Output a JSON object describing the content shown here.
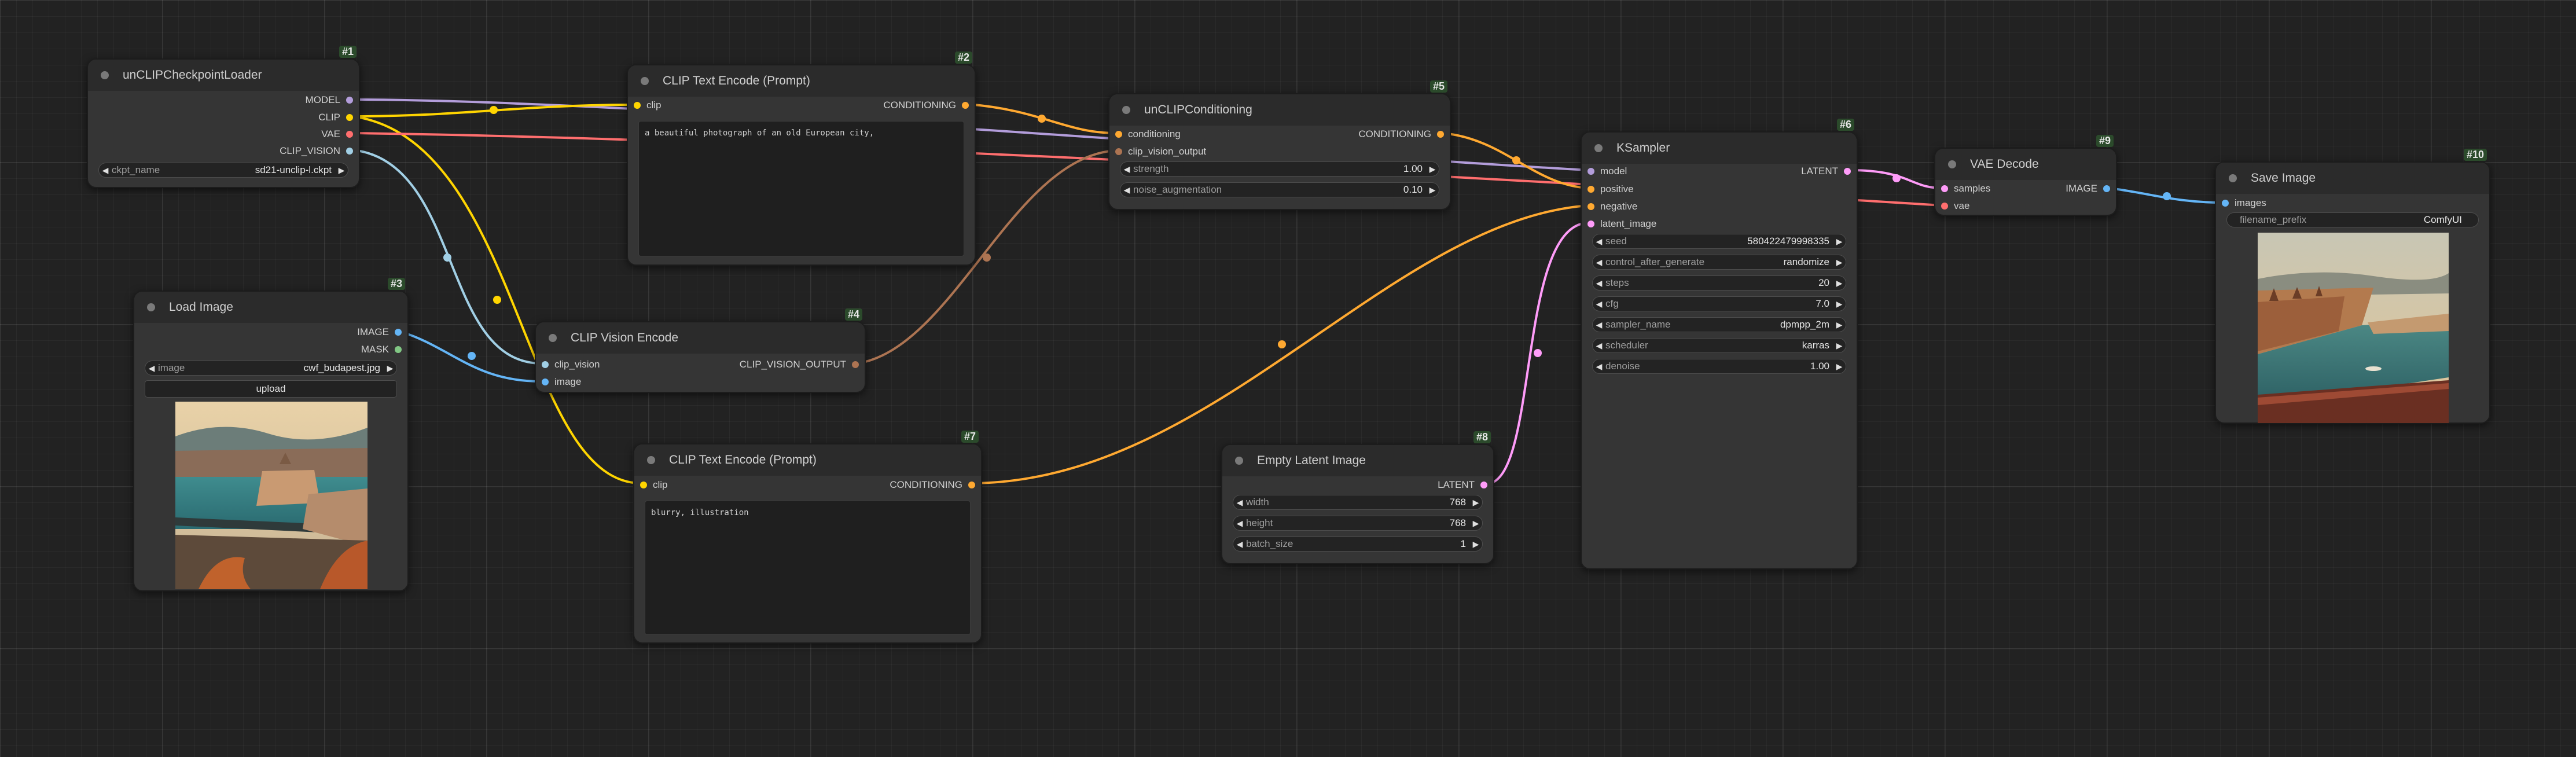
{
  "colors": {
    "model": "#b39ddb",
    "clip": "#ffd500",
    "vae": "#ff6e6e",
    "clip_vision": "#a1cfe5",
    "clip_vision_output": "#ad7452",
    "conditioning": "#ffa931",
    "latent": "#ff9cf9",
    "image": "#64b5f6",
    "accent_id": "#2b4a2b"
  },
  "nodes": {
    "checkpoint": {
      "id": "#1",
      "title": "unCLIPCheckpointLoader",
      "outputs": [
        "MODEL",
        "CLIP",
        "VAE",
        "CLIP_VISION"
      ],
      "widgets": [
        {
          "label": "ckpt_name",
          "value": "sd21-unclip-l.ckpt"
        }
      ]
    },
    "text_pos": {
      "id": "#2",
      "title": "CLIP Text Encode (Prompt)",
      "inputs": [
        "clip"
      ],
      "outputs": [
        "CONDITIONING"
      ],
      "text": "a beautiful photograph of an old European city,"
    },
    "load_image": {
      "id": "#3",
      "title": "Load Image",
      "outputs": [
        "IMAGE",
        "MASK"
      ],
      "widgets": [
        {
          "label": "image",
          "value": "cwf_budapest.jpg"
        }
      ],
      "upload_label": "upload",
      "preview_alt": "Budapest river panorama preview"
    },
    "clip_vision_encode": {
      "id": "#4",
      "title": "CLIP Vision Encode",
      "inputs": [
        "clip_vision",
        "image"
      ],
      "outputs": [
        "CLIP_VISION_OUTPUT"
      ]
    },
    "unclip_cond": {
      "id": "#5",
      "title": "unCLIPConditioning",
      "inputs": [
        "conditioning",
        "clip_vision_output"
      ],
      "outputs": [
        "CONDITIONING"
      ],
      "widgets": [
        {
          "label": "strength",
          "value": "1.00"
        },
        {
          "label": "noise_augmentation",
          "value": "0.10"
        }
      ]
    },
    "ksampler": {
      "id": "#6",
      "title": "KSampler",
      "inputs": [
        "model",
        "positive",
        "negative",
        "latent_image"
      ],
      "outputs": [
        "LATENT"
      ],
      "widgets": [
        {
          "label": "seed",
          "value": "580422479998335"
        },
        {
          "label": "control_after_generate",
          "value": "randomize"
        },
        {
          "label": "steps",
          "value": "20"
        },
        {
          "label": "cfg",
          "value": "7.0"
        },
        {
          "label": "sampler_name",
          "value": "dpmpp_2m"
        },
        {
          "label": "scheduler",
          "value": "karras"
        },
        {
          "label": "denoise",
          "value": "1.00"
        }
      ]
    },
    "text_neg": {
      "id": "#7",
      "title": "CLIP Text Encode (Prompt)",
      "inputs": [
        "clip"
      ],
      "outputs": [
        "CONDITIONING"
      ],
      "text": "blurry, illustration"
    },
    "empty_latent": {
      "id": "#8",
      "title": "Empty Latent Image",
      "outputs": [
        "LATENT"
      ],
      "widgets": [
        {
          "label": "width",
          "value": "768"
        },
        {
          "label": "height",
          "value": "768"
        },
        {
          "label": "batch_size",
          "value": "1"
        }
      ]
    },
    "vae_decode": {
      "id": "#9",
      "title": "VAE Decode",
      "inputs": [
        "samples",
        "vae"
      ],
      "outputs": [
        "IMAGE"
      ]
    },
    "save_image": {
      "id": "#10",
      "title": "Save Image",
      "inputs": [
        "images"
      ],
      "widgets": [
        {
          "label": "filename_prefix",
          "value": "ComfyUI"
        }
      ],
      "preview_alt": "Generated European city river panorama"
    }
  }
}
